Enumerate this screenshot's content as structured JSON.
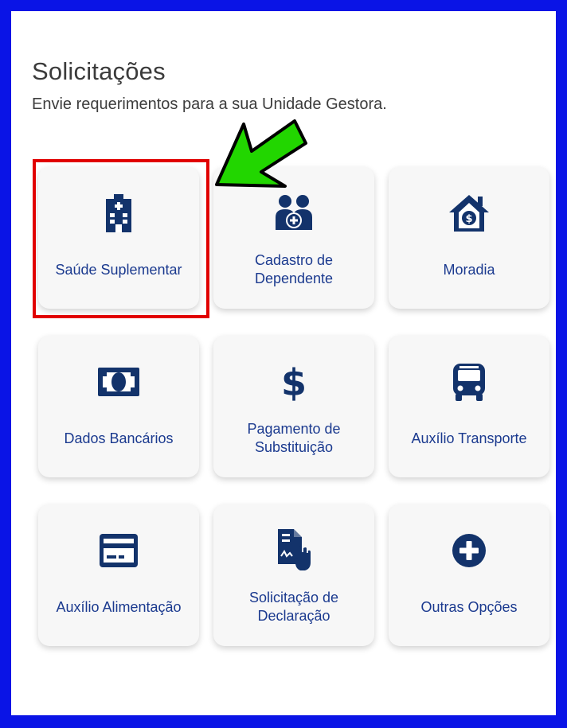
{
  "page": {
    "title": "Solicitações",
    "subtitle": "Envie requerimentos para a sua Unidade Gestora."
  },
  "colors": {
    "frame": "#0a14e6",
    "icon": "#13336b",
    "label": "#1b3a8f",
    "highlight": "#e10000",
    "arrow": "#22d600"
  },
  "cards": [
    {
      "label": "Saúde Suplementar",
      "icon": "hospital-icon"
    },
    {
      "label": "Cadastro de\nDependente",
      "icon": "family-medical-icon"
    },
    {
      "label": "Moradia",
      "icon": "house-dollar-icon"
    },
    {
      "label": "Dados Bancários",
      "icon": "banknote-icon"
    },
    {
      "label": "Pagamento de\nSubstituição",
      "icon": "dollar-sign-icon"
    },
    {
      "label": "Auxílio Transporte",
      "icon": "bus-icon"
    },
    {
      "label": "Auxílio Alimentação",
      "icon": "card-icon"
    },
    {
      "label": "Solicitação de\nDeclaração",
      "icon": "signed-document-icon"
    },
    {
      "label": "Outras Opções",
      "icon": "plus-circle-icon"
    }
  ]
}
